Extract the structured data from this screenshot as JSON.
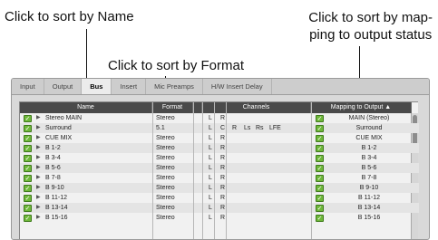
{
  "annotations": {
    "sort_name": "Click to sort by Name",
    "sort_format": "Click to sort by Format",
    "sort_mapping_line1": "Click to sort by map-",
    "sort_mapping_line2": "ping to output status"
  },
  "tabs": [
    "Input",
    "Output",
    "Bus",
    "Insert",
    "Mic Preamps",
    "H/W Insert Delay"
  ],
  "active_tab": "Bus",
  "columns": {
    "name": "Name",
    "format": "Format",
    "channels": "Channels",
    "mapping": "Mapping to Output ▲"
  },
  "rows": [
    {
      "name": "Stereo MAIN",
      "format": "Stereo",
      "channels": [
        "L",
        "R"
      ],
      "mapping": "MAIN (Stereo)"
    },
    {
      "name": "Surround",
      "format": "5.1",
      "channels": [
        "L",
        "C",
        "R",
        "Ls",
        "Rs",
        "LFE"
      ],
      "mapping": "Surround"
    },
    {
      "name": "CUE MIX",
      "format": "Stereo",
      "channels": [
        "L",
        "R"
      ],
      "mapping": "CUE MIX"
    },
    {
      "name": "B 1-2",
      "format": "Stereo",
      "channels": [
        "L",
        "R"
      ],
      "mapping": "B 1-2"
    },
    {
      "name": "B 3-4",
      "format": "Stereo",
      "channels": [
        "L",
        "R"
      ],
      "mapping": "B 3-4"
    },
    {
      "name": "B 5-6",
      "format": "Stereo",
      "channels": [
        "L",
        "R"
      ],
      "mapping": "B 5-6"
    },
    {
      "name": "B 7-8",
      "format": "Stereo",
      "channels": [
        "L",
        "R"
      ],
      "mapping": "B 7-8"
    },
    {
      "name": "B 9-10",
      "format": "Stereo",
      "channels": [
        "L",
        "R"
      ],
      "mapping": "B 9-10"
    },
    {
      "name": "B 11-12",
      "format": "Stereo",
      "channels": [
        "L",
        "R"
      ],
      "mapping": "B 11-12"
    },
    {
      "name": "B 13-14",
      "format": "Stereo",
      "channels": [
        "L",
        "R"
      ],
      "mapping": "B 13-14"
    },
    {
      "name": "B 15-16",
      "format": "Stereo",
      "channels": [
        "L",
        "R"
      ],
      "mapping": "B 15-16"
    }
  ],
  "icons": {
    "checkbox": "checkbox-checked-icon",
    "expand": "disclosure-triangle-icon"
  },
  "colors": {
    "header": "#4a4a4a",
    "checkbox": "#6fb83a"
  }
}
